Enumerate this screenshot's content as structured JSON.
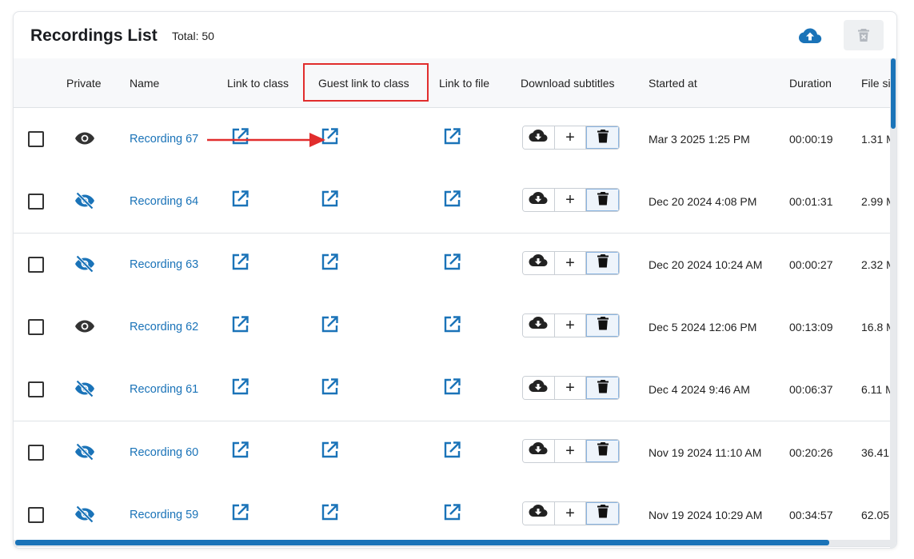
{
  "header": {
    "title": "Recordings List",
    "total": "Total: 50",
    "upload_icon": "cloud-upload-icon",
    "delete_all_icon": "delete-box-icon"
  },
  "columns": {
    "private": "Private",
    "name": "Name",
    "link_to_class": "Link to class",
    "guest_link_to_class": "Guest link to class",
    "link_to_file": "Link to file",
    "download_subtitles": "Download subtitles",
    "started_at": "Started at",
    "duration": "Duration",
    "file_size": "File si"
  },
  "colors": {
    "accent": "#1a73b8",
    "highlight": "#e12d2d",
    "icon_dark": "#333333"
  },
  "rows": [
    {
      "private": "visible",
      "name": "Recording 67",
      "started": "Mar 3 2025 1:25 PM",
      "duration": "00:00:19",
      "size": "1.31 M"
    },
    {
      "private": "hidden",
      "name": "Recording 64",
      "started": "Dec 20 2024 4:08 PM",
      "duration": "00:01:31",
      "size": "2.99 M"
    },
    {
      "private": "hidden",
      "name": "Recording 63",
      "started": "Dec 20 2024 10:24 AM",
      "duration": "00:00:27",
      "size": "2.32 M"
    },
    {
      "private": "visible",
      "name": "Recording 62",
      "started": "Dec 5 2024 12:06 PM",
      "duration": "00:13:09",
      "size": "16.8 M"
    },
    {
      "private": "hidden",
      "name": "Recording 61",
      "started": "Dec 4 2024 9:46 AM",
      "duration": "00:06:37",
      "size": "6.11 M"
    },
    {
      "private": "hidden",
      "name": "Recording 60",
      "started": "Nov 19 2024 11:10 AM",
      "duration": "00:20:26",
      "size": "36.41"
    },
    {
      "private": "hidden",
      "name": "Recording 59",
      "started": "Nov 19 2024 10:29 AM",
      "duration": "00:34:57",
      "size": "62.05"
    }
  ]
}
